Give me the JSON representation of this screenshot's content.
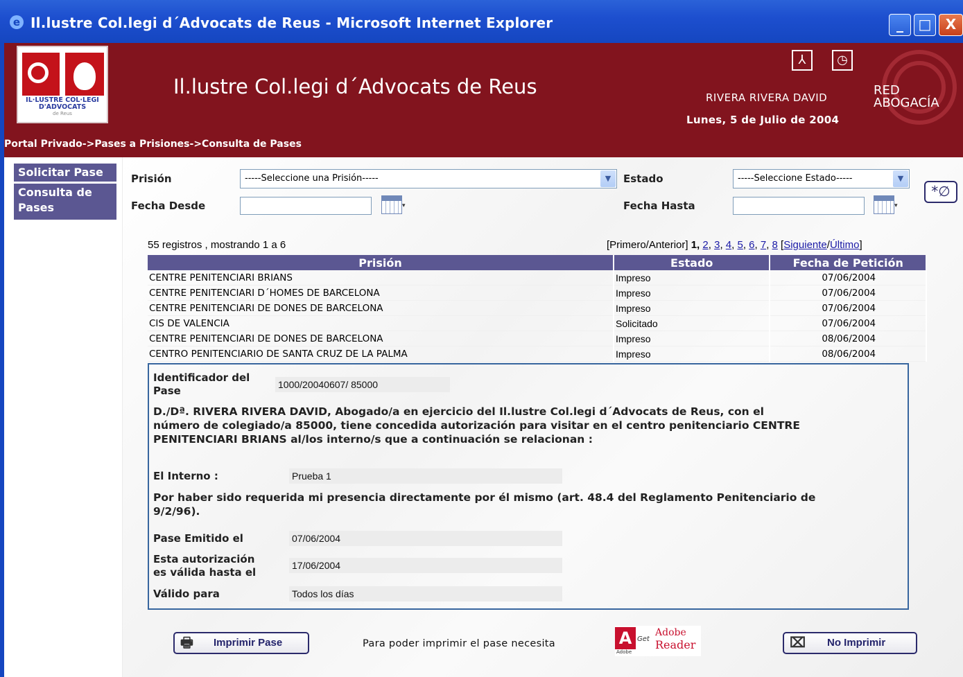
{
  "window": {
    "title": "Il.lustre Col.legi d´Advocats de Reus - Microsoft Internet Explorer",
    "min_label": "_",
    "max_label": "□",
    "close_label": "X"
  },
  "header": {
    "logo_text": "IL·LUSTRE COL·LEGI D'ADVOCATS",
    "logo_subtext": "de Reus",
    "site_title": "Il.lustre Col.legi d´Advocats de Reus",
    "user_name": "RIVERA RIVERA DAVID",
    "date": "Lunes, 5 de Julio de 2004",
    "red_line1": "RED",
    "red_line2": "ABOGACÍA",
    "breadcrumb": "Portal Privado->Pases a Prisiones->Consulta de Pases"
  },
  "nav": {
    "items": [
      {
        "label": "Solicitar Pase"
      },
      {
        "label": "Consulta de Pases"
      }
    ]
  },
  "filters": {
    "prision_label": "Prisión",
    "prision_value": "-----Seleccione una Prisión-----",
    "estado_label": "Estado",
    "estado_value": "-----Seleccione Estado-----",
    "fecha_desde_label": "Fecha Desde",
    "fecha_hasta_label": "Fecha Hasta",
    "fecha_desde_value": "",
    "fecha_hasta_value": ""
  },
  "results": {
    "count_text": "55 registros , mostrando 1 a 6",
    "pager": {
      "prefix": "[Primero/Anterior]",
      "current": "1,",
      "pages": [
        "2",
        "3",
        "4",
        "5",
        "6",
        "7",
        "8"
      ],
      "next": "Siguiente",
      "last": "Último"
    },
    "columns": [
      "Prisión",
      "Estado",
      "Fecha de Petición"
    ],
    "rows": [
      {
        "prision": "CENTRE PENITENCIARI BRIANS",
        "estado": "Impreso",
        "fecha": "07/06/2004"
      },
      {
        "prision": "CENTRE PENITENCIARI D´HOMES DE BARCELONA",
        "estado": "Impreso",
        "fecha": "07/06/2004"
      },
      {
        "prision": "CENTRE PENITENCIARI DE DONES DE BARCELONA",
        "estado": "Impreso",
        "fecha": "07/06/2004"
      },
      {
        "prision": "CIS DE VALENCIA",
        "estado": "Solicitado",
        "fecha": "07/06/2004"
      },
      {
        "prision": "CENTRE PENITENCIARI DE DONES DE BARCELONA",
        "estado": "Impreso",
        "fecha": "08/06/2004"
      },
      {
        "prision": "CENTRO PENITENCIARIO DE SANTA CRUZ DE LA PALMA",
        "estado": "Impreso",
        "fecha": "08/06/2004"
      }
    ]
  },
  "detail": {
    "id_label_1": "Identificador del",
    "id_label_2": "Pase",
    "id_value": "1000/20040607/ 85000",
    "para_line1": "D./Dª. RIVERA RIVERA DAVID, Abogado/a en ejercicio del Il.lustre Col.legi d´Advocats de Reus, con el",
    "para_line2": "número de colegiado/a 85000, tiene concedida autorización para visitar en el centro penitenciario CENTRE",
    "para_line3": "PENITENCIARI BRIANS al/los interno/s que a continuación se relacionan :",
    "interno_label": "El Interno :",
    "interno_value": "Prueba 1",
    "motivo_line1": "Por haber sido requerida mi presencia directamente por él mismo (art. 48.4 del Reglamento Penitenciario de",
    "motivo_line2": "9/2/96).",
    "emitido_label": "Pase Emitido el",
    "emitido_value": "07/06/2004",
    "valida_label_1": "Esta autorización",
    "valida_label_2": "es válida hasta el",
    "valida_value": "17/06/2004",
    "valido_para_label": "Válido para",
    "valido_para_value": "Todos los días"
  },
  "actions": {
    "print_label": "Imprimir Pase",
    "need_text": "Para poder imprimir el pase necesita",
    "adobe_get": "Get",
    "adobe_line1": "Adobe",
    "adobe_line2": "Reader",
    "adobe_small": "Adobe",
    "no_print_label": "No Imprimir"
  },
  "colors": {
    "header_bg": "#82141e",
    "nav_bg": "#5b5792",
    "titlebar": "#1d4fcf"
  },
  "icons": [
    "ie-icon",
    "people-icon",
    "clock-icon",
    "calendar-icon",
    "clear-filter-icon",
    "printer-icon",
    "no-print-icon"
  ]
}
